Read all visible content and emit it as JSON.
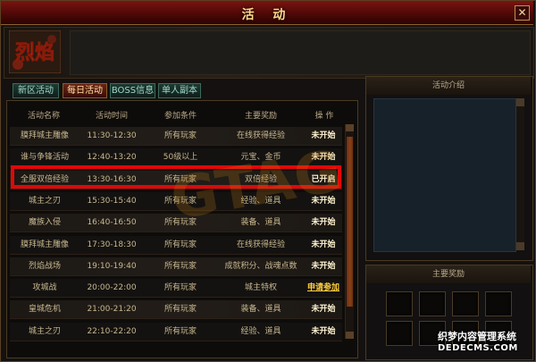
{
  "window": {
    "title": "活 动",
    "close_glyph": "✕"
  },
  "logo": {
    "text": "烈焰"
  },
  "tabs": [
    {
      "label": "新区活动"
    },
    {
      "label": "每日活动",
      "active": true
    },
    {
      "label": "BOSS信息"
    },
    {
      "label": "单人副本"
    }
  ],
  "table": {
    "headers": [
      "活动名称",
      "活动时间",
      "参加条件",
      "主要奖励",
      "操 作"
    ],
    "rows": [
      {
        "name": "膜拜城主雕像",
        "time": "11:30-12:30",
        "cond": "所有玩家",
        "reward": "在线获得经验",
        "status": "未开始",
        "kind": "no"
      },
      {
        "name": "谁与争锋活动",
        "time": "12:40-13:20",
        "cond": "50级以上",
        "reward": "元宝、金币",
        "status": "未开始",
        "kind": "no"
      },
      {
        "name": "全服双倍经验",
        "time": "13:30-16:30",
        "cond": "所有玩家",
        "reward": "双倍经验",
        "status": "已开启",
        "kind": "open"
      },
      {
        "name": "城主之刃",
        "time": "15:30-15:40",
        "cond": "所有玩家",
        "reward": "经验、道具",
        "status": "未开始",
        "kind": "no"
      },
      {
        "name": "魔族入侵",
        "time": "16:40-16:50",
        "cond": "所有玩家",
        "reward": "装备、道具",
        "status": "未开始",
        "kind": "no"
      },
      {
        "name": "膜拜城主雕像",
        "time": "17:30-18:30",
        "cond": "所有玩家",
        "reward": "在线获得经验",
        "status": "未开始",
        "kind": "no"
      },
      {
        "name": "烈焰战场",
        "time": "19:10-19:40",
        "cond": "所有玩家",
        "reward": "成就积分、战魂点数",
        "status": "未开始",
        "kind": "no"
      },
      {
        "name": "攻城战",
        "time": "20:00-22:00",
        "cond": "所有玩家",
        "reward": "城主特权",
        "status": "申请参加",
        "kind": "apply"
      },
      {
        "name": "皇城危机",
        "time": "21:00-21:20",
        "cond": "所有玩家",
        "reward": "装备、道具",
        "status": "未开始",
        "kind": "no"
      },
      {
        "name": "城主之刃",
        "time": "22:10-22:20",
        "cond": "所有玩家",
        "reward": "经验、道具",
        "status": "未开始",
        "kind": "no"
      }
    ]
  },
  "intro": {
    "title": "活动介绍"
  },
  "rewards": {
    "title": "主要奖励"
  },
  "watermark": {
    "text": "GTAGZ"
  },
  "site": {
    "cn": "织梦内容管理系统",
    "url": "DEDECMS.COM"
  },
  "colors": {
    "accent_red": "#e00808",
    "title_gold": "#ffd98a",
    "tab_active": "#6a2414"
  }
}
